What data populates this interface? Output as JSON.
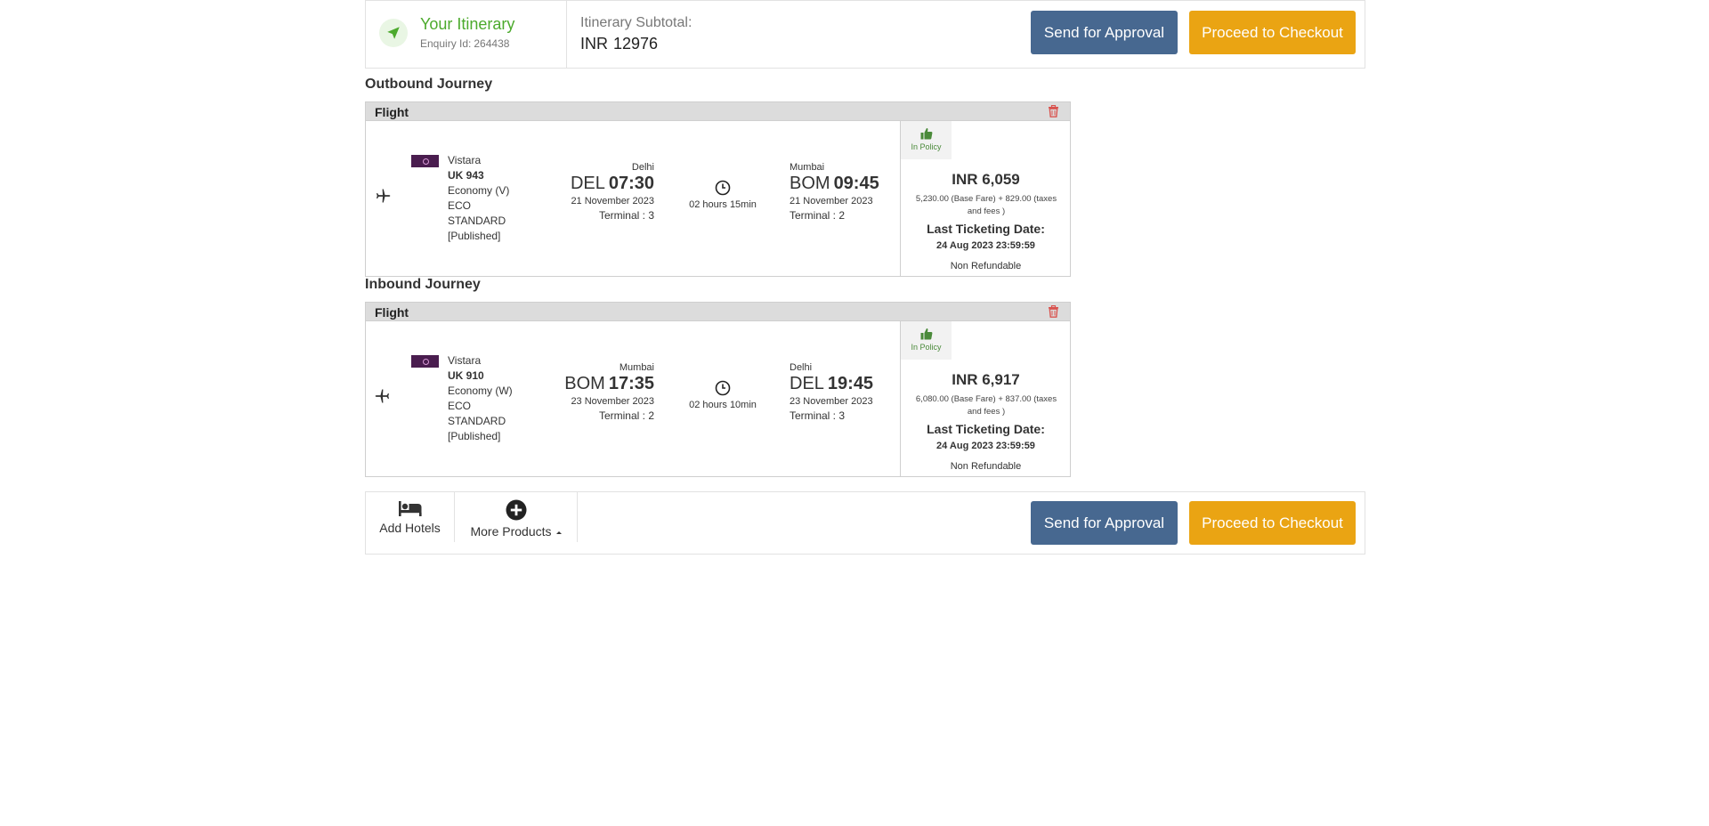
{
  "header": {
    "title": "Your Itinerary",
    "enquiry_label": "Enquiry Id:",
    "enquiry_id": "264438",
    "subtotal_label": "Itinerary Subtotal:",
    "subtotal_currency": "INR",
    "subtotal_amount": "12976",
    "send_approval_label": "Send for Approval",
    "checkout_label": "Proceed to Checkout"
  },
  "journeys": [
    {
      "title": "Outbound Journey",
      "card_title": "Flight",
      "airline": "Vistara",
      "flight_no": "UK 943",
      "cabin": "Economy (V)",
      "fare_type": "ECO STANDARD [Published]",
      "depart": {
        "city": "Delhi",
        "code": "DEL",
        "time": "07:30",
        "date": "21 November 2023",
        "terminal": "Terminal : 3"
      },
      "duration": "02 hours 15min",
      "arrive": {
        "city": "Mumbai",
        "code": "BOM",
        "time": "09:45",
        "date": "21 November 2023",
        "terminal": "Terminal : 2"
      },
      "policy": "In Policy",
      "price": "INR 6,059",
      "breakdown": "5,230.00 (Base Fare) + 829.00 (taxes and fees )",
      "ltd_label": "Last Ticketing Date:",
      "ltd_value": "24 Aug 2023 23:59:59",
      "refund": "Non Refundable"
    },
    {
      "title": "Inbound Journey",
      "card_title": "Flight",
      "airline": "Vistara",
      "flight_no": "UK 910",
      "cabin": "Economy (W)",
      "fare_type": "ECO STANDARD [Published]",
      "depart": {
        "city": "Mumbai",
        "code": "BOM",
        "time": "17:35",
        "date": "23 November 2023",
        "terminal": "Terminal : 2"
      },
      "duration": "02 hours 10min",
      "arrive": {
        "city": "Delhi",
        "code": "DEL",
        "time": "19:45",
        "date": "23 November 2023",
        "terminal": "Terminal : 3"
      },
      "policy": "In Policy",
      "price": "INR 6,917",
      "breakdown": "6,080.00 (Base Fare) + 837.00 (taxes and fees )",
      "ltd_label": "Last Ticketing Date:",
      "ltd_value": "24 Aug 2023 23:59:59",
      "refund": "Non Refundable"
    }
  ],
  "footer": {
    "add_hotels_label": "Add Hotels",
    "more_products_label": "More Products",
    "send_approval_label": "Send for Approval",
    "checkout_label": "Proceed to Checkout"
  },
  "colors": {
    "accent_green": "#4caa2d",
    "approval_blue": "#476890",
    "checkout_orange": "#eaa413",
    "delete_red": "#d9534f",
    "airline_logo": "#4a1d4f"
  },
  "icons": [
    "navigation-arrow-icon",
    "trash-icon",
    "airplane-icon",
    "clock-icon",
    "thumbs-up-icon",
    "bed-icon",
    "plus-circle-icon",
    "caret-up-icon"
  ]
}
